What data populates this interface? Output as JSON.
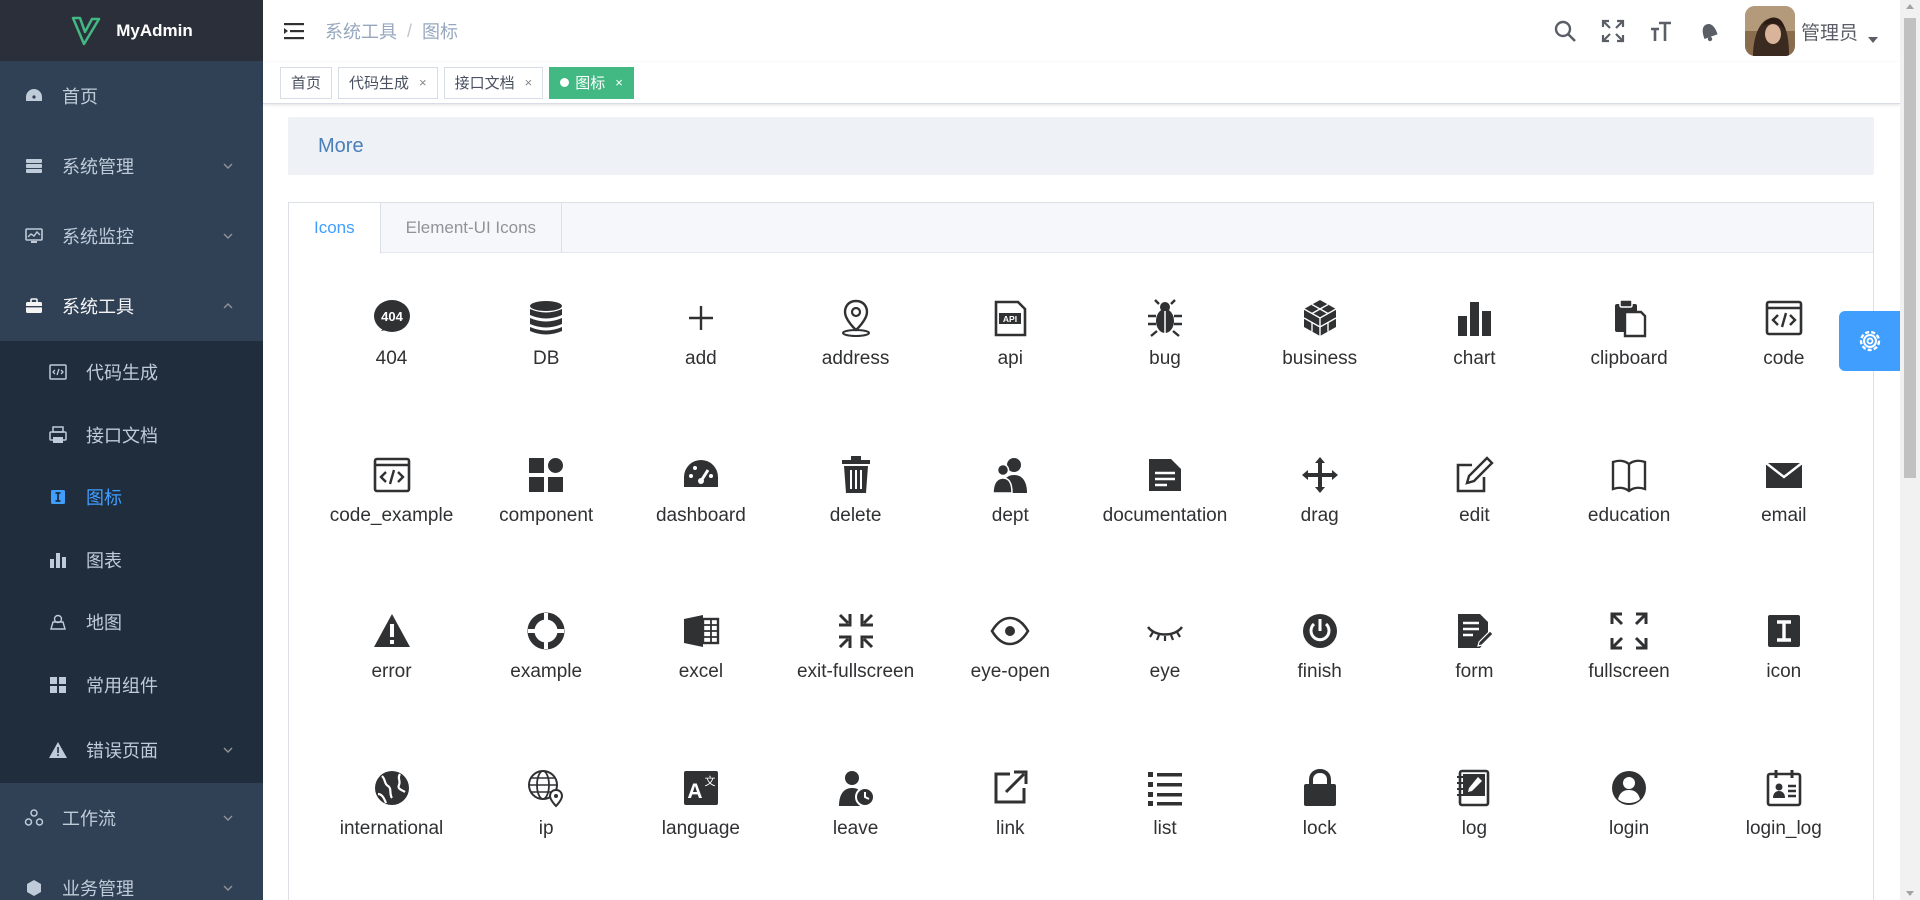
{
  "app": {
    "title": "MyAdmin"
  },
  "sidebar": {
    "items": [
      {
        "label": "首页",
        "icon": "dashboard-icon"
      },
      {
        "label": "系统管理",
        "icon": "system-icon",
        "expandable": true
      },
      {
        "label": "系统监控",
        "icon": "monitor-icon",
        "expandable": true
      },
      {
        "label": "系统工具",
        "icon": "tool-icon",
        "expandable": true,
        "open": true
      },
      {
        "label": "工作流",
        "icon": "workflow-icon",
        "expandable": true
      },
      {
        "label": "业务管理",
        "icon": "business-icon",
        "expandable": true
      }
    ],
    "tool_submenu": [
      {
        "label": "代码生成",
        "icon": "code-icon"
      },
      {
        "label": "接口文档",
        "icon": "printer-icon"
      },
      {
        "label": "图标",
        "icon": "icon-icon",
        "active": true
      },
      {
        "label": "图表",
        "icon": "chart-icon"
      },
      {
        "label": "地图",
        "icon": "map-icon"
      },
      {
        "label": "常用组件",
        "icon": "component-icon"
      },
      {
        "label": "错误页面",
        "icon": "warning-icon",
        "expandable": true
      }
    ]
  },
  "header": {
    "breadcrumb": [
      "系统工具",
      "图标"
    ],
    "username": "管理员"
  },
  "tags": [
    {
      "label": "首页",
      "closable": false,
      "active": false
    },
    {
      "label": "代码生成",
      "closable": true,
      "active": false
    },
    {
      "label": "接口文档",
      "closable": true,
      "active": false
    },
    {
      "label": "图标",
      "closable": true,
      "active": true
    }
  ],
  "tag_close_glyph": "×",
  "main": {
    "more_label": "More",
    "tabs": [
      {
        "label": "Icons",
        "active": true
      },
      {
        "label": "Element-UI Icons",
        "active": false
      }
    ],
    "icons": [
      "404",
      "DB",
      "add",
      "address",
      "api",
      "bug",
      "business",
      "chart",
      "clipboard",
      "code",
      "code_example",
      "component",
      "dashboard",
      "delete",
      "dept",
      "documentation",
      "drag",
      "edit",
      "education",
      "email",
      "error",
      "example",
      "excel",
      "exit-fullscreen",
      "eye-open",
      "eye",
      "finish",
      "form",
      "fullscreen",
      "icon",
      "international",
      "ip",
      "language",
      "leave",
      "link",
      "list",
      "lock",
      "log",
      "login",
      "login_log"
    ]
  },
  "colors": {
    "sidebar_bg": "#304156",
    "submenu_bg": "#1f2d3d",
    "accent": "#409eff",
    "tag_active": "#42b983"
  }
}
